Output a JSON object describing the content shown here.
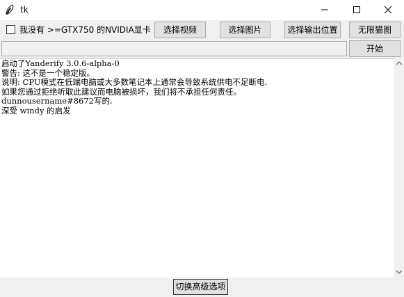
{
  "window": {
    "title": "tk",
    "icon": "feather-icon",
    "controls": [
      "minimize-icon",
      "maximize-icon",
      "close-icon"
    ]
  },
  "toolbar": {
    "gpu_checkbox": {
      "label": "我没有 >=GTX750 的NVIDIA显卡",
      "checked": false
    },
    "select_video_label": "选择视频",
    "select_image_label": "选择图片",
    "select_output_label": "选择输出位置",
    "infinite_cat_label": "无限猫图",
    "start_label": "开始"
  },
  "path_entry": {
    "value": ""
  },
  "log": {
    "lines": [
      "启动了Yanderify 3.0.6-alpha-0",
      "警告: 这不是一个稳定版。",
      "说明: CPU模式在低端电脑或大多数笔记本上通常会导致系统供电不足断电.",
      "如果您通过拒绝听取此建议而电脑被损坏，我们将不承担任何责任。",
      "dunnousername#8672写的.",
      "深受 windy 的启发"
    ]
  },
  "footer": {
    "toggle_advanced_label": "切换高级选项"
  }
}
